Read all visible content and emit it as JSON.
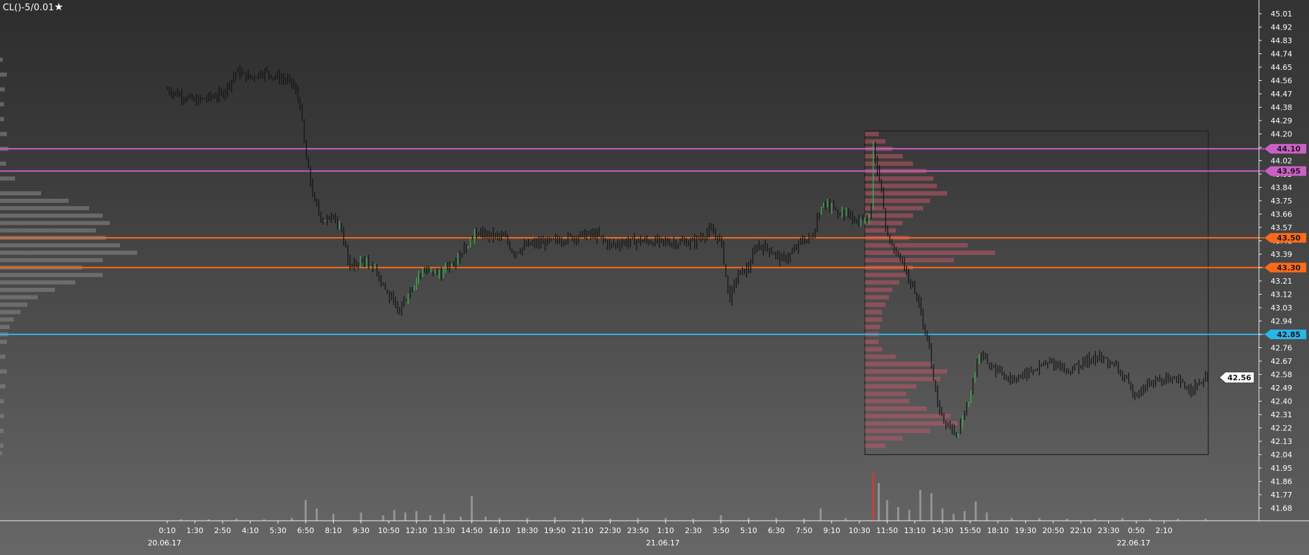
{
  "header": {
    "symbol": "CL()-5/0.01",
    "favorite_icon": "star-icon"
  },
  "colors": {
    "upper_resistance": "#cc5fc6",
    "middle_level": "#ff6a1a",
    "support": "#2bb4e8",
    "profile_window": "#c05868",
    "volume_bar": "#9a9a9a",
    "volume_bar_peak": "#d33a3a",
    "bar_up": "#37b34a",
    "bar_down": "#141414"
  },
  "chart_data": {
    "type": "ohlc",
    "grid": false,
    "y_axis": {
      "position": "right",
      "range": [
        41.62,
        45.05
      ],
      "ticks": [
        "45.01",
        "44.92",
        "44.83",
        "44.74",
        "44.65",
        "44.56",
        "44.47",
        "44.38",
        "44.29",
        "44.20",
        "44.11",
        "44.02",
        "43.93",
        "43.84",
        "43.75",
        "43.66",
        "43.57",
        "43.48",
        "43.39",
        "43.30",
        "43.21",
        "43.12",
        "43.03",
        "42.94",
        "42.85",
        "42.76",
        "42.67",
        "42.58",
        "42.49",
        "42.40",
        "42.31",
        "42.22",
        "42.13",
        "42.04",
        "41.95",
        "41.86",
        "41.77",
        "41.68"
      ]
    },
    "x_axis": {
      "ticks": [
        "0:10",
        "1:30",
        "2:50",
        "4:10",
        "5:30",
        "6:50",
        "8:10",
        "9:30",
        "10:50",
        "12:10",
        "13:30",
        "14:50",
        "16:10",
        "18:30",
        "19:50",
        "21:10",
        "22:30",
        "23:50",
        "1:10",
        "2:30",
        "3:50",
        "5:10",
        "6:30",
        "7:50",
        "9:10",
        "10:30",
        "11:50",
        "13:10",
        "14:30",
        "15:50",
        "18:10",
        "19:30",
        "20:50",
        "22:10",
        "23:30",
        "0:50",
        "2:10"
      ],
      "dates": [
        "20.06.17",
        "21.06.17",
        "22.06.17"
      ]
    },
    "levels": [
      {
        "value": 44.1,
        "label": "44.10",
        "role": "upper_resistance"
      },
      {
        "value": 43.95,
        "label": "43.95",
        "role": "upper_resistance"
      },
      {
        "value": 43.5,
        "label": "43.50",
        "role": "middle_level"
      },
      {
        "value": 43.3,
        "label": "43.30",
        "role": "middle_level"
      },
      {
        "value": 42.85,
        "label": "42.85",
        "role": "support"
      }
    ],
    "last_price": "42.56",
    "price_path": [
      [
        0.0,
        44.5
      ],
      [
        1.0,
        44.42
      ],
      [
        2.0,
        44.47
      ],
      [
        2.5,
        44.62
      ],
      [
        3.0,
        44.58
      ],
      [
        3.5,
        44.62
      ],
      [
        4.0,
        44.58
      ],
      [
        4.5,
        44.55
      ],
      [
        4.8,
        44.4
      ],
      [
        5.0,
        44.05
      ],
      [
        5.3,
        43.75
      ],
      [
        5.6,
        43.62
      ],
      [
        6.0,
        43.66
      ],
      [
        6.3,
        43.55
      ],
      [
        6.6,
        43.3
      ],
      [
        7.0,
        43.35
      ],
      [
        7.5,
        43.3
      ],
      [
        8.0,
        43.1
      ],
      [
        8.4,
        43.02
      ],
      [
        8.8,
        43.15
      ],
      [
        9.3,
        43.3
      ],
      [
        9.8,
        43.25
      ],
      [
        10.3,
        43.32
      ],
      [
        10.8,
        43.45
      ],
      [
        11.1,
        43.53
      ],
      [
        11.6,
        43.52
      ],
      [
        12.2,
        43.5
      ],
      [
        12.5,
        43.4
      ],
      [
        13.0,
        43.45
      ],
      [
        14.0,
        43.48
      ],
      [
        15.0,
        43.52
      ],
      [
        15.5,
        43.52
      ],
      [
        16.0,
        43.45
      ],
      [
        16.5,
        43.47
      ],
      [
        17.0,
        43.48
      ],
      [
        18.0,
        43.47
      ],
      [
        19.0,
        43.47
      ],
      [
        19.6,
        43.55
      ],
      [
        20.0,
        43.48
      ],
      [
        20.3,
        43.08
      ],
      [
        20.6,
        43.25
      ],
      [
        21.0,
        43.3
      ],
      [
        21.3,
        43.45
      ],
      [
        21.7,
        43.43
      ],
      [
        22.2,
        43.35
      ],
      [
        22.6,
        43.4
      ],
      [
        22.9,
        43.48
      ],
      [
        23.3,
        43.5
      ],
      [
        23.6,
        43.72
      ],
      [
        24.0,
        43.7
      ],
      [
        24.5,
        43.66
      ],
      [
        25.0,
        43.6
      ],
      [
        25.4,
        43.62
      ],
      [
        25.5,
        44.1
      ],
      [
        25.8,
        43.8
      ],
      [
        26.0,
        43.5
      ],
      [
        26.5,
        43.35
      ],
      [
        27.0,
        43.15
      ],
      [
        27.5,
        42.8
      ],
      [
        27.8,
        42.4
      ],
      [
        28.1,
        42.25
      ],
      [
        28.5,
        42.18
      ],
      [
        28.7,
        42.25
      ],
      [
        29.0,
        42.45
      ],
      [
        29.3,
        42.7
      ],
      [
        29.5,
        42.68
      ],
      [
        30.0,
        42.6
      ],
      [
        30.5,
        42.55
      ],
      [
        31.0,
        42.58
      ],
      [
        31.5,
        42.63
      ],
      [
        32.0,
        42.66
      ],
      [
        32.5,
        42.6
      ],
      [
        33.0,
        42.65
      ],
      [
        33.5,
        42.7
      ],
      [
        34.0,
        42.67
      ],
      [
        34.5,
        42.58
      ],
      [
        34.8,
        42.48
      ],
      [
        35.0,
        42.45
      ],
      [
        35.5,
        42.52
      ],
      [
        36.0,
        42.55
      ],
      [
        36.5,
        42.53
      ],
      [
        37.0,
        42.48
      ],
      [
        37.6,
        42.56
      ]
    ],
    "composite_profile": [
      [
        44.7,
        4
      ],
      [
        44.6,
        10
      ],
      [
        44.5,
        7
      ],
      [
        44.4,
        6
      ],
      [
        44.3,
        6
      ],
      [
        44.2,
        10
      ],
      [
        44.1,
        12
      ],
      [
        44.0,
        9
      ],
      [
        43.9,
        22
      ],
      [
        43.8,
        60
      ],
      [
        43.75,
        100
      ],
      [
        43.7,
        130
      ],
      [
        43.65,
        150
      ],
      [
        43.6,
        160
      ],
      [
        43.55,
        140
      ],
      [
        43.5,
        155
      ],
      [
        43.45,
        175
      ],
      [
        43.4,
        200
      ],
      [
        43.35,
        150
      ],
      [
        43.3,
        120
      ],
      [
        43.25,
        150
      ],
      [
        43.2,
        110
      ],
      [
        43.15,
        80
      ],
      [
        43.1,
        55
      ],
      [
        43.05,
        40
      ],
      [
        43.0,
        30
      ],
      [
        42.95,
        20
      ],
      [
        42.9,
        14
      ],
      [
        42.85,
        12
      ],
      [
        42.8,
        10
      ],
      [
        42.7,
        8
      ],
      [
        42.6,
        10
      ],
      [
        42.5,
        8
      ],
      [
        42.4,
        6
      ],
      [
        42.3,
        6
      ],
      [
        42.2,
        5
      ],
      [
        42.1,
        5
      ],
      [
        42.05,
        3
      ]
    ],
    "session_profile": {
      "price_range": [
        42.04,
        44.22
      ],
      "time_range": [
        25.2,
        37.6
      ],
      "levels": [
        [
          44.2,
          20
        ],
        [
          44.15,
          30
        ],
        [
          44.1,
          40
        ],
        [
          44.05,
          55
        ],
        [
          44.0,
          70
        ],
        [
          43.95,
          90
        ],
        [
          43.9,
          100
        ],
        [
          43.85,
          105
        ],
        [
          43.8,
          120
        ],
        [
          43.75,
          95
        ],
        [
          43.7,
          85
        ],
        [
          43.65,
          70
        ],
        [
          43.6,
          55
        ],
        [
          43.55,
          45
        ],
        [
          43.5,
          65
        ],
        [
          43.45,
          150
        ],
        [
          43.4,
          190
        ],
        [
          43.35,
          130
        ],
        [
          43.3,
          70
        ],
        [
          43.25,
          60
        ],
        [
          43.2,
          50
        ],
        [
          43.15,
          40
        ],
        [
          43.1,
          35
        ],
        [
          43.05,
          30
        ],
        [
          43.0,
          25
        ],
        [
          42.95,
          25
        ],
        [
          42.9,
          22
        ],
        [
          42.85,
          20
        ],
        [
          42.8,
          20
        ],
        [
          42.75,
          25
        ],
        [
          42.7,
          45
        ],
        [
          42.65,
          100
        ],
        [
          42.6,
          120
        ],
        [
          42.55,
          110
        ],
        [
          42.5,
          75
        ],
        [
          42.45,
          60
        ],
        [
          42.4,
          65
        ],
        [
          42.35,
          90
        ],
        [
          42.3,
          125
        ],
        [
          42.25,
          135
        ],
        [
          42.2,
          95
        ],
        [
          42.15,
          55
        ],
        [
          42.1,
          30
        ]
      ]
    },
    "volume": [
      [
        0.5,
        2
      ],
      [
        1.5,
        2
      ],
      [
        2.5,
        3
      ],
      [
        3.5,
        2
      ],
      [
        4.5,
        4
      ],
      [
        5.0,
        30
      ],
      [
        5.4,
        18
      ],
      [
        6.0,
        10
      ],
      [
        7.0,
        12
      ],
      [
        7.8,
        8
      ],
      [
        8.2,
        16
      ],
      [
        8.6,
        12
      ],
      [
        9.0,
        14
      ],
      [
        9.5,
        8
      ],
      [
        10.0,
        10
      ],
      [
        10.6,
        6
      ],
      [
        11.0,
        36
      ],
      [
        11.5,
        6
      ],
      [
        12.0,
        4
      ],
      [
        13.0,
        4
      ],
      [
        14.0,
        5
      ],
      [
        15.0,
        4
      ],
      [
        16.0,
        3
      ],
      [
        17.0,
        4
      ],
      [
        18.0,
        4
      ],
      [
        19.0,
        3
      ],
      [
        20.0,
        8
      ],
      [
        21.0,
        4
      ],
      [
        22.0,
        4
      ],
      [
        23.0,
        3
      ],
      [
        23.6,
        18
      ],
      [
        24.5,
        4
      ],
      [
        25.5,
        70
      ],
      [
        25.7,
        55
      ],
      [
        26.0,
        30
      ],
      [
        26.4,
        20
      ],
      [
        26.8,
        16
      ],
      [
        27.2,
        45
      ],
      [
        27.6,
        40
      ],
      [
        28.0,
        18
      ],
      [
        28.4,
        10
      ],
      [
        28.8,
        14
      ],
      [
        29.2,
        28
      ],
      [
        29.6,
        12
      ],
      [
        30.5,
        4
      ],
      [
        31.5,
        4
      ],
      [
        32.5,
        3
      ],
      [
        33.5,
        3
      ],
      [
        34.5,
        4
      ],
      [
        35.5,
        3
      ],
      [
        36.5,
        3
      ],
      [
        37.5,
        3
      ]
    ],
    "volume_peak_index": 32
  }
}
